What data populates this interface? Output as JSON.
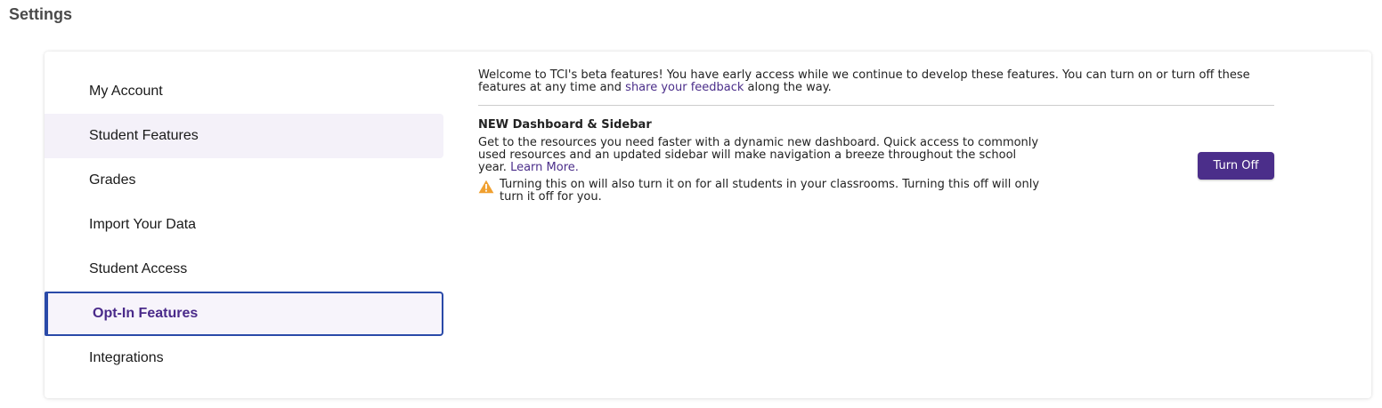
{
  "page": {
    "title": "Settings"
  },
  "sidebar": {
    "items": [
      {
        "label": "My Account"
      },
      {
        "label": "Student Features"
      },
      {
        "label": "Grades"
      },
      {
        "label": "Import Your Data"
      },
      {
        "label": "Student Access"
      },
      {
        "label": "Opt-In Features"
      },
      {
        "label": "Integrations"
      }
    ]
  },
  "intro": {
    "text_before": "Welcome to TCI's beta features! You have early access while we continue to develop these features. You can turn on or turn off these features at any time and ",
    "link": "share your feedback",
    "text_after": " along the way."
  },
  "feature": {
    "title": "NEW Dashboard & Sidebar",
    "description": "Get to the resources you need faster with a dynamic new dashboard. Quick access to commonly used resources and an updated sidebar will make navigation a breeze throughout the school year. ",
    "learn_more": "Learn More.",
    "warning": "Turning this on will also turn it on for all students in your classrooms. Turning this off will only turn it off for you.",
    "button_label": "Turn Off"
  },
  "colors": {
    "accent": "#4b2e8a",
    "active_border": "#2a4aa8",
    "warning": "#f0a030"
  },
  "icons": {
    "warning": "warning-triangle-icon"
  }
}
